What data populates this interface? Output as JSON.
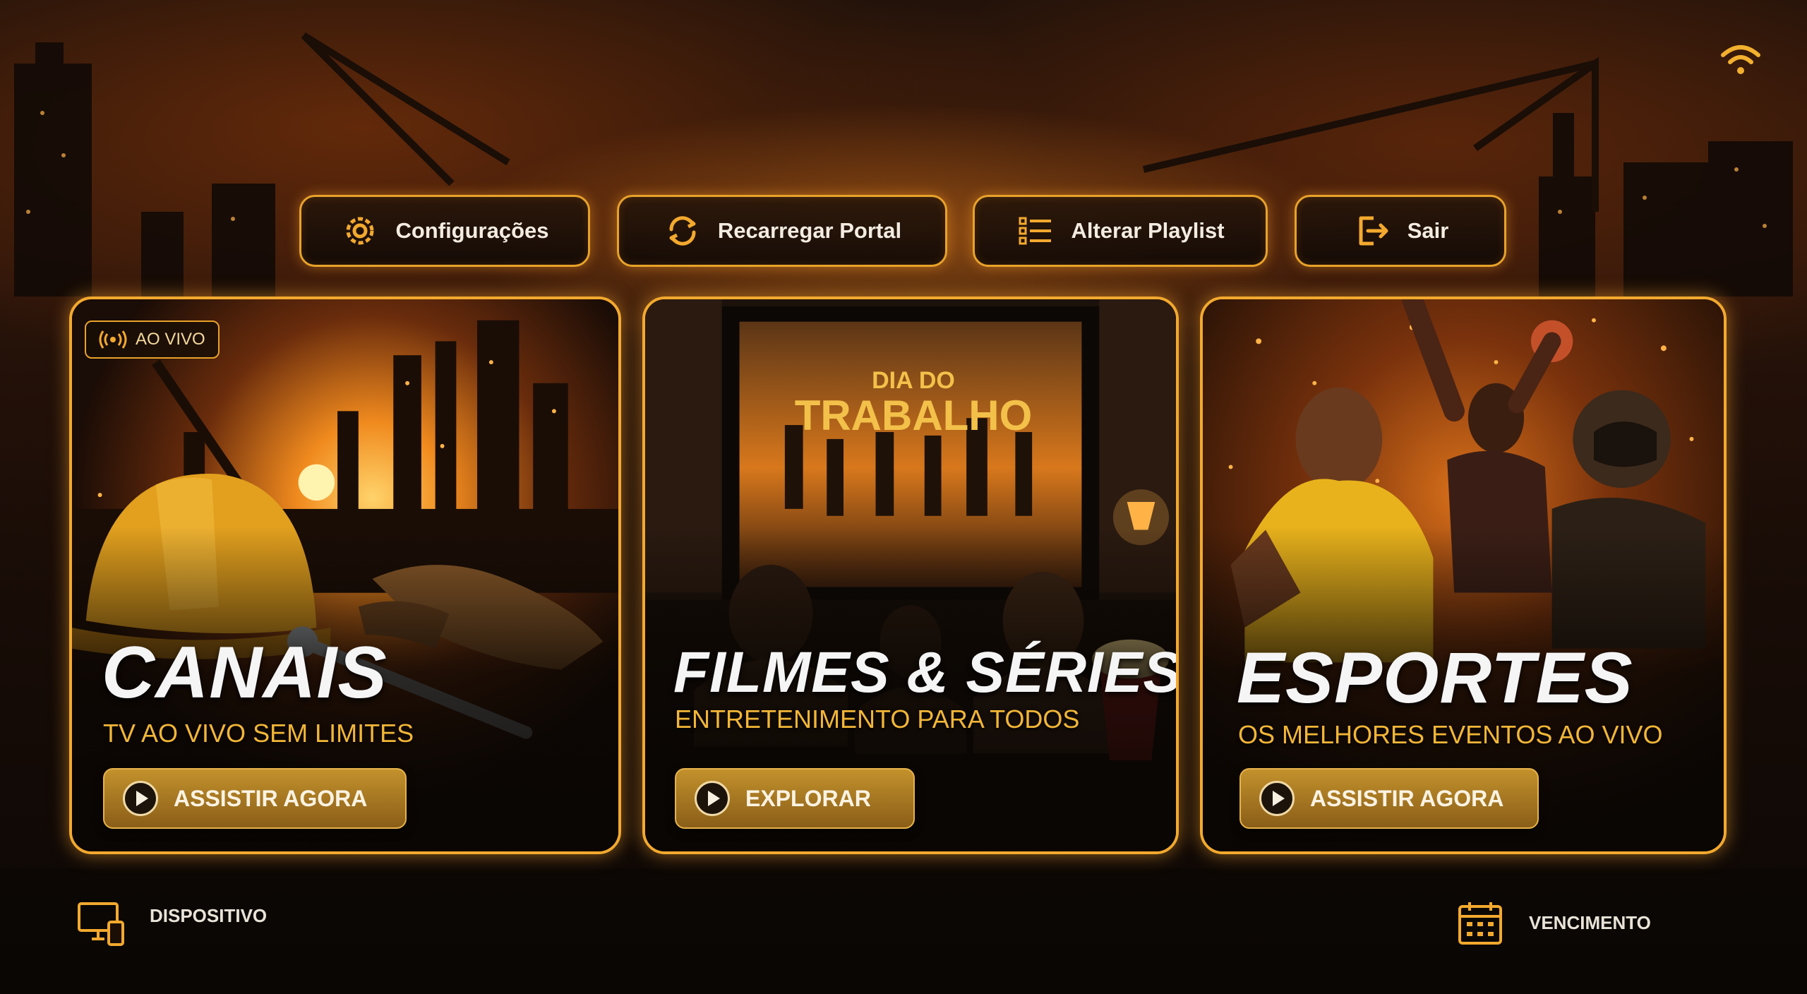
{
  "top_menu": {
    "settings_label": "Configurações",
    "reload_label": "Recarregar Portal",
    "playlist_label": "Alterar Playlist",
    "exit_label": "Sair"
  },
  "cards": {
    "channels": {
      "badge": "AO VIVO",
      "title": "CANAIS",
      "subtitle": "TV AO VIVO SEM LIMITES",
      "cta": "ASSISTIR AGORA"
    },
    "movies": {
      "title": "FILMES & SÉRIES",
      "subtitle": "ENTRETENIMENTO PARA TODOS",
      "cta": "EXPLORAR",
      "poster_line1": "DIA DO",
      "poster_line2": "TRABALHO"
    },
    "sports": {
      "title": "ESPORTES",
      "subtitle": "OS MELHORES EVENTOS AO VIVO",
      "cta": "ASSISTIR AGORA"
    }
  },
  "footer": {
    "device_label": "DISPOSITIVO",
    "expiry_label": "VENCIMENTO"
  },
  "colors": {
    "accent": "#f3a92e",
    "subtitle": "#f2b637",
    "cta": "#b07d24"
  },
  "icons": [
    "wifi-icon",
    "gear-icon",
    "refresh-icon",
    "playlist-icon",
    "exit-icon",
    "live-icon",
    "play-icon",
    "device-icon",
    "calendar-icon"
  ]
}
